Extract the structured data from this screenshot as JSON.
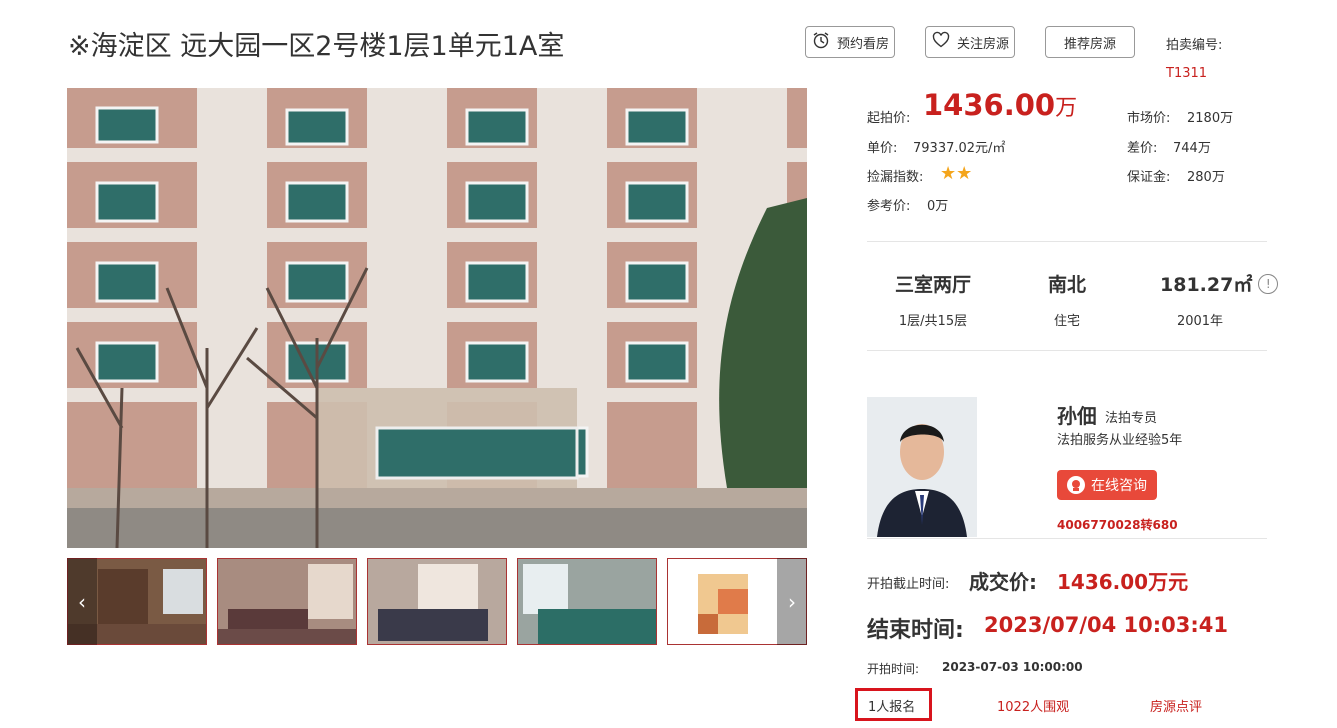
{
  "title": "※海淀区 远大园一区2号楼1层1单元1A室",
  "actions": {
    "book_label": "预约看房",
    "follow_label": "关注房源",
    "recommend_label": "推荐房源"
  },
  "auction": {
    "no_label": "拍卖编号:",
    "no_value": "T1311"
  },
  "price": {
    "start_label": "起拍价:",
    "start_value": "1436.00",
    "start_unit": "万",
    "unit_label": "单价:",
    "unit_value": "79337.02元/㎡",
    "index_label": "捡漏指数:",
    "index_stars": 2,
    "ref_label": "参考价:",
    "ref_value": "0万",
    "market_label": "市场价:",
    "market_value": "2180万",
    "diff_label": "差价:",
    "diff_value": "744万",
    "deposit_label": "保证金:",
    "deposit_value": "280万"
  },
  "specs": {
    "layout": "三室两厅",
    "floor": "1层/共15层",
    "orientation": "南北",
    "usage": "住宅",
    "area": "181.27㎡",
    "year": "2001年"
  },
  "agent": {
    "name": "孙佃",
    "title": "法拍专员",
    "experience": "法拍服务从业经验5年",
    "consult_label": "在线咨询",
    "phone": "4006770028转680"
  },
  "result": {
    "deadline_label": "开拍截止时间:",
    "deal_label": "成交价:",
    "deal_value": "1436.00万元",
    "end_label": "结束时间:",
    "end_value": "2023/07/04 10:03:41",
    "start_label": "开拍时间:",
    "start_value": "2023-07-03 10:00:00"
  },
  "stats": {
    "signup": "1人报名",
    "viewers": "1022人围观",
    "review": "房源点评"
  },
  "colors": {
    "accent": "#c8211e",
    "consult": "#e8493a",
    "highlight_box": "#d8141d",
    "star": "#f4a51c"
  }
}
